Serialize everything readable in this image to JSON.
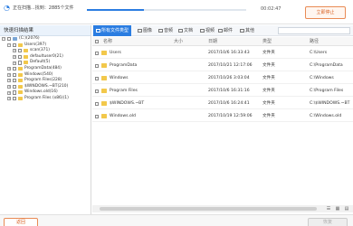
{
  "scan": {
    "status": "正在扫描...找到：2885个文件",
    "progress": 0.36,
    "elapsed": "00:02:47",
    "stop_label": "立即停止"
  },
  "tree": {
    "header": "快速扫描结果",
    "items": [
      {
        "label": "(C:)(2076)",
        "depth": 0,
        "expander": "−",
        "is_drive": true
      },
      {
        "label": "Users(397)",
        "depth": 1,
        "expander": "−"
      },
      {
        "label": "scan(371)",
        "depth": 2,
        "expander": "+"
      },
      {
        "label": "defaultuser0(21)",
        "depth": 2,
        "expander": "+"
      },
      {
        "label": "Default(5)",
        "depth": 2,
        "expander": "+"
      },
      {
        "label": "ProgramData(484)",
        "depth": 1,
        "expander": "+"
      },
      {
        "label": "Windows(540)",
        "depth": 1,
        "expander": "+"
      },
      {
        "label": "Program Files(228)",
        "depth": 1,
        "expander": "+"
      },
      {
        "label": "$WINDOWS.~BT(210)",
        "depth": 1,
        "expander": "+"
      },
      {
        "label": "Windows.old(16)",
        "depth": 1,
        "expander": "+"
      },
      {
        "label": "Program Files (x86)(1)",
        "depth": 1,
        "expander": "+"
      }
    ]
  },
  "filters": {
    "tabs": [
      {
        "label": "所有文件类型",
        "active": true
      },
      {
        "label": "图像",
        "active": false
      },
      {
        "label": "音频",
        "active": false
      },
      {
        "label": "文档",
        "active": false
      },
      {
        "label": "视频",
        "active": false
      },
      {
        "label": "邮件",
        "active": false
      },
      {
        "label": "其他",
        "active": false
      }
    ]
  },
  "columns": {
    "name": "名称",
    "size": "大小",
    "date": "日期",
    "type": "类型",
    "path": "路径"
  },
  "files": [
    {
      "name": "Users",
      "size": "",
      "date": "2017/10/6 16:33:43",
      "type": "文件夹",
      "path": "C:\\Users"
    },
    {
      "name": "ProgramData",
      "size": "",
      "date": "2017/10/21 12:17:06",
      "type": "文件夹",
      "path": "C:\\ProgramData"
    },
    {
      "name": "Windows",
      "size": "",
      "date": "2017/10/26 3:03:04",
      "type": "文件夹",
      "path": "C:\\Windows"
    },
    {
      "name": "Program Files",
      "size": "",
      "date": "2017/10/6 16:31:16",
      "type": "文件夹",
      "path": "C:\\Program Files"
    },
    {
      "name": "$WINDOWS.~BT",
      "size": "",
      "date": "2017/10/6 16:24:41",
      "type": "文件夹",
      "path": "C:\\$WINDOWS.~BT"
    },
    {
      "name": "Windows.old",
      "size": "",
      "date": "2017/10/19 12:59:06",
      "type": "文件夹",
      "path": "C:\\Windows.old"
    }
  ],
  "bottom": {
    "back_label": "返回",
    "recover_label": "恢复"
  },
  "colors": {
    "accent": "#2b7de1",
    "stop": "#d96224",
    "folder": "#f2c84b"
  }
}
